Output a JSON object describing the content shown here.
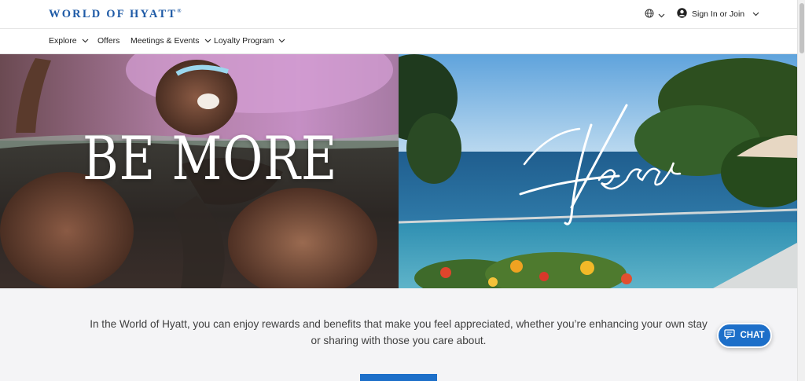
{
  "brand": {
    "name": "WORLD OF HYATT",
    "mark": "®"
  },
  "header": {
    "language_icon": "globe-icon",
    "sign_in_label": "Sign In or Join"
  },
  "nav": {
    "items": [
      {
        "label": "Explore",
        "has_dropdown": true
      },
      {
        "label": "Offers",
        "has_dropdown": false
      },
      {
        "label": "Meetings & Events",
        "has_dropdown": true
      },
      {
        "label": "Loyalty Program",
        "has_dropdown": true
      }
    ]
  },
  "hero": {
    "headline": "BE MORE",
    "script_word": "Here"
  },
  "intro": {
    "text": "In the World of Hyatt, you can enjoy rewards and benefits that make you feel appreciated, whether you’re enhancing your own stay or sharing with those you care about."
  },
  "chat": {
    "label": "CHAT",
    "icon": "chat-icon"
  },
  "colors": {
    "brand_blue": "#1e5aa6",
    "cta_blue": "#1d6fc9",
    "page_bg": "#f4f4f6"
  }
}
